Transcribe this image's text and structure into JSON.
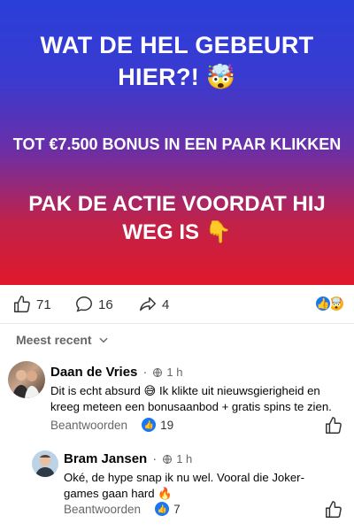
{
  "banner": {
    "line1": "WAT DE HEL GEBEURT HIER?! 🤯",
    "line2": "TOT €7.500 BONUS IN EEN PAAR KLIKKEN",
    "line3": "PAK DE ACTIE VOORDAT HIJ WEG IS 👇"
  },
  "reactions": {
    "likes": "71",
    "comments": "16",
    "shares": "4",
    "emoji_like": "👍",
    "emoji_wow": "🤯"
  },
  "sort": {
    "label": "Meest recent"
  },
  "comments": [
    {
      "name": "Daan de Vries",
      "time": "1 h",
      "text": "Dit is echt absurd 😅 Ik klikte uit nieuwsgierigheid en kreeg meteen een bonusaanbod + gratis spins te zien.",
      "reply_label": "Beantwoorden",
      "likes": "19"
    },
    {
      "name": "Bram Jansen",
      "time": "1 h",
      "text": "Oké, de hype snap ik nu wel. Vooral die Joker-games gaan hard 🔥",
      "reply_label": "Beantwoorden",
      "likes": "7"
    }
  ],
  "colors": {
    "accent": "#1877f2",
    "banner_top": "#2a3fd8",
    "banner_bottom": "#e0182a"
  }
}
